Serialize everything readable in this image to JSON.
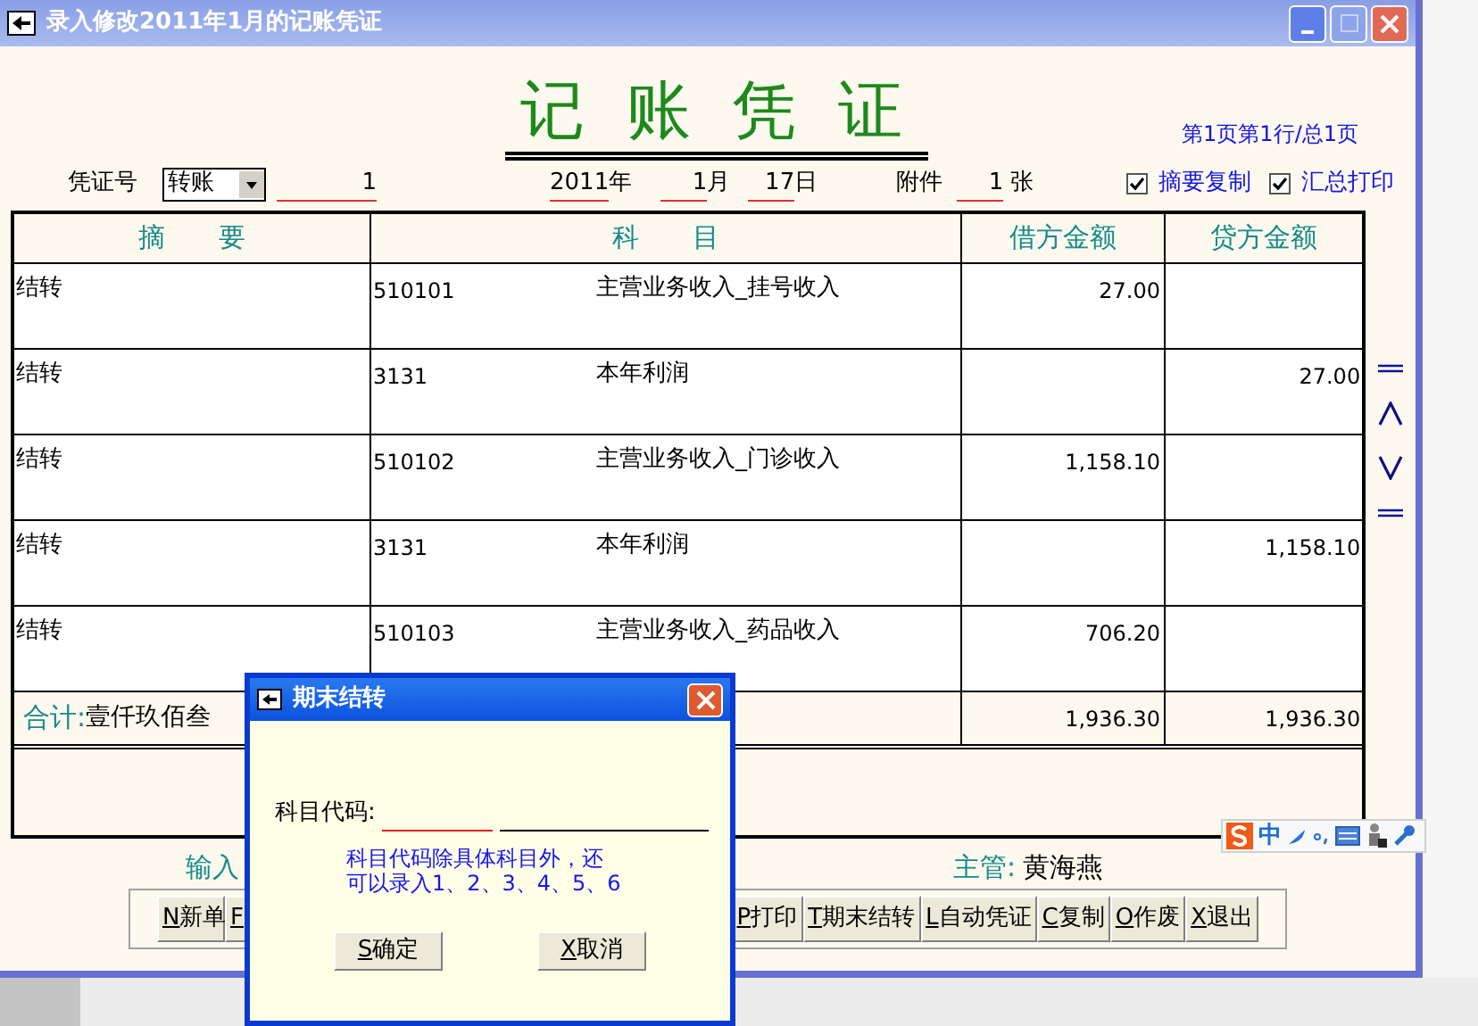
{
  "window": {
    "title": "录入修改2011年1月的记账凭证"
  },
  "voucher": {
    "title": "记 账 凭 证",
    "page_info": "第1页第1行/总1页",
    "fields": {
      "type_label": "凭证号",
      "type_value": "转账",
      "number": "1",
      "year": "2011",
      "year_unit": "年",
      "month": "1",
      "month_unit": "月",
      "day": "17",
      "day_unit": "日",
      "attach_label": "附件",
      "attach_count": "1",
      "attach_unit": "张"
    },
    "options": [
      {
        "label": "摘要复制",
        "checked": true
      },
      {
        "label": "汇总打印",
        "checked": true
      }
    ]
  },
  "table": {
    "columns": [
      "摘　　要",
      "科　　目",
      "借方金额",
      "贷方金额"
    ],
    "rows": [
      {
        "summary": "结转",
        "code": "510101",
        "subject": "主营业务收入_挂号收入",
        "debit": "27.00"
      },
      {
        "summary": "结转",
        "code": "3131",
        "subject": "本年利润",
        "credit": "27.00"
      },
      {
        "summary": "结转",
        "code": "510102",
        "subject": "主营业务收入_门诊收入",
        "debit": "1,158.10"
      },
      {
        "summary": "结转",
        "code": "3131",
        "subject": "本年利润",
        "credit": "1,158.10"
      },
      {
        "summary": "结转",
        "code": "510103",
        "subject": "主营业务收入_药品收入",
        "debit": "706.20"
      }
    ],
    "total": {
      "label": "合计:",
      "amount_words": "壹仟玖佰叁",
      "debit": "1,936.30",
      "credit": "1,936.30"
    }
  },
  "footer": {
    "entry_label": "输入",
    "supervisor_label": "主管:",
    "supervisor": "黄海燕"
  },
  "toolbar_left": [
    "N新单",
    "F"
  ],
  "toolbar_right": [
    "P打印",
    "T期末结转",
    "L自动凭证",
    "C复制",
    "O作废",
    "X退出"
  ],
  "ime": {
    "mode": "中"
  },
  "dialog": {
    "title": "期末结转",
    "label": "科目代码:",
    "hint_lines": [
      "科目代码除具体科目外，还",
      "可以录入1、2、3、4、5、6"
    ],
    "buttons": [
      "S确定",
      "X取消"
    ]
  }
}
